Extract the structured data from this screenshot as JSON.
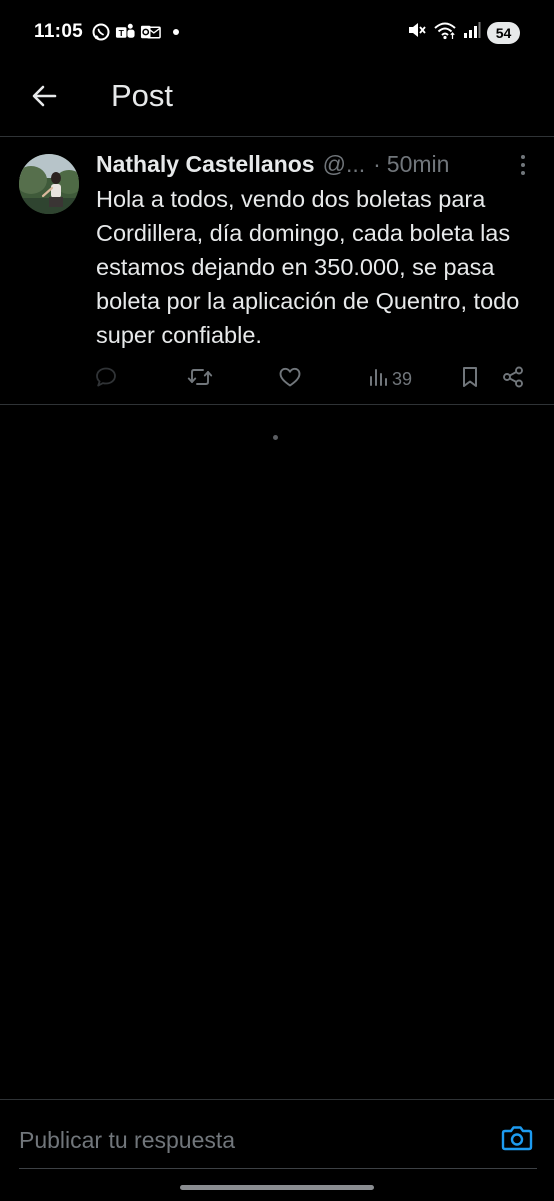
{
  "status_bar": {
    "time": "11:05",
    "battery": "54",
    "app_icons": [
      "whatsapp-icon",
      "teams-icon",
      "outlook-icon",
      "notification-dot-icon"
    ],
    "system_icons": [
      "mute-icon",
      "wifi-icon",
      "signal-icon"
    ]
  },
  "header": {
    "title": "Post",
    "back_icon": "back-arrow-icon"
  },
  "post": {
    "author": "Nathaly Castellanos",
    "handle": "@...",
    "separator": "·",
    "time_ago": "50min",
    "text": "Hola a todos, vendo dos boletas para Cordillera, día domingo, cada boleta las estamos dejando en 350.000, se pasa boleta por la aplicación de Quentro, todo super confiable.",
    "views": "39",
    "action_icons": [
      "reply-icon",
      "repost-icon",
      "like-icon",
      "views-icon",
      "bookmark-icon",
      "share-icon"
    ]
  },
  "reply": {
    "placeholder": "Publicar tu respuesta",
    "camera_icon": "camera-icon"
  },
  "colors": {
    "background": "#000000",
    "text": "#e7e9ea",
    "muted": "#71767b",
    "divider": "#2f3336",
    "accent": "#1d9bf0"
  }
}
